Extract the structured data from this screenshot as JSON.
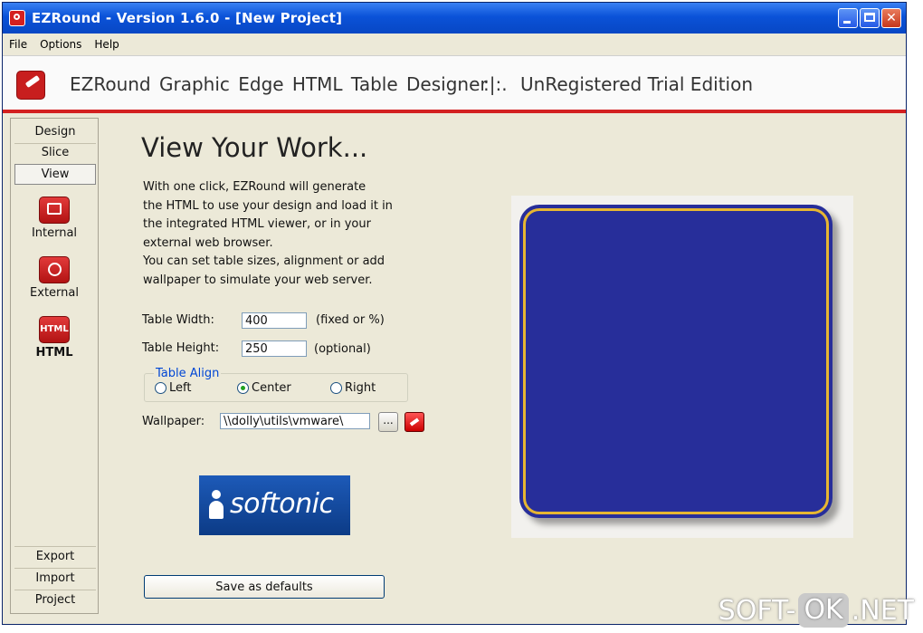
{
  "window": {
    "title": "EZRound - Version 1.6.0 - [New Project]"
  },
  "menu": [
    "File",
    "Options",
    "Help"
  ],
  "banner": {
    "app_name": "EZRound Graphic Edge HTML Table Designer",
    "separator": ":|:.",
    "edition": "UnRegistered Trial Edition"
  },
  "sidebar": {
    "tabs": [
      "Design",
      "Slice",
      "View"
    ],
    "tools": [
      {
        "label": "Internal",
        "icon": "monitor-icon"
      },
      {
        "label": "External",
        "icon": "globe-icon"
      },
      {
        "label": "HTML",
        "icon": "html-icon"
      }
    ],
    "bottom": [
      "Export",
      "Import",
      "Project"
    ]
  },
  "main": {
    "title": "View Your Work...",
    "description": [
      "With one click, EZRound will generate",
      "the HTML to use your design and load it in",
      "the integrated HTML viewer, or in your",
      "external web browser.",
      "You can set table sizes, alignment or add",
      "wallpaper to simulate your web server."
    ],
    "width": {
      "label": "Table Width:",
      "value": "400",
      "hint": "(fixed or %)"
    },
    "height": {
      "label": "Table Height:",
      "value": "250",
      "hint": "(optional)"
    },
    "align": {
      "legend": "Table Align",
      "options": [
        "Left",
        "Center",
        "Right"
      ],
      "selected": "Center"
    },
    "wallpaper": {
      "label": "Wallpaper:",
      "value": "\\\\dolly\\utils\\vmware\\",
      "browse_label": "..."
    },
    "logo_text": "softonic",
    "save_label": "Save as defaults"
  },
  "preview": {
    "fill_color": "#272e9a",
    "border_color": "#e6b632"
  },
  "watermark": {
    "left": "SOFT-",
    "middle": "OK",
    "right": ".NET"
  }
}
